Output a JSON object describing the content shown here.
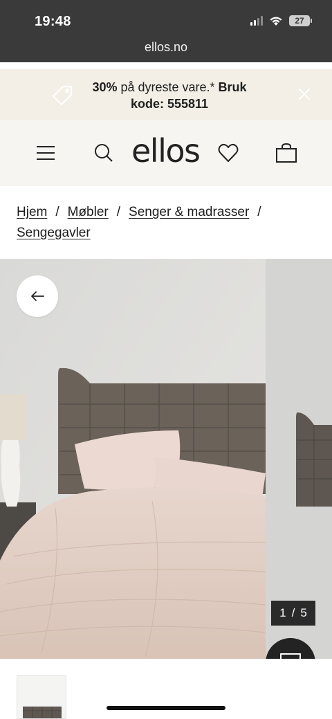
{
  "status_bar": {
    "time": "19:48",
    "battery": "27",
    "icons": [
      "signal-icon",
      "wifi-icon",
      "battery-icon"
    ]
  },
  "browser": {
    "url": "ellos.no"
  },
  "promo": {
    "text_bold_1": "30%",
    "text_regular": " på dyreste vare.* ",
    "text_bold_2": "Bruk kode: 555811",
    "icons": [
      "tag-icon",
      "close-icon"
    ]
  },
  "header": {
    "logo": "ellos",
    "icons": [
      "menu-icon",
      "search-icon",
      "heart-icon",
      "bag-icon"
    ]
  },
  "breadcrumb": {
    "items": [
      "Hjem",
      "Møbler",
      "Senger & madrasser",
      "Sengegavler"
    ],
    "separator": "/"
  },
  "gallery": {
    "current": "1",
    "separator": "/",
    "total": "5",
    "icons": [
      "arrow-left-icon",
      "chat-icon"
    ]
  },
  "colors": {
    "browser_bar": "#3a3a3a",
    "promo_bg": "#f3efe6",
    "header_bg": "#f6f5f2",
    "counter_bg": "#2a2a2a"
  }
}
